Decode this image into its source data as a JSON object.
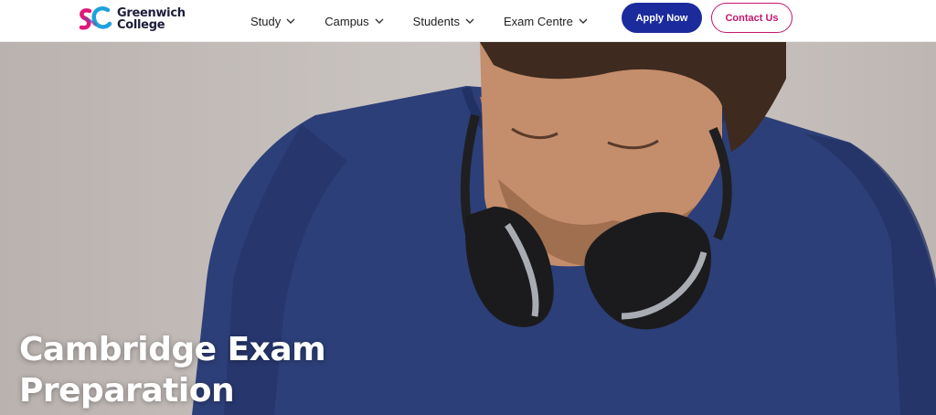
{
  "brand": {
    "line1": "Greenwich",
    "line2": "College",
    "colors": {
      "magenta": "#e0187a",
      "blue": "#1fa2dc",
      "navy": "#1c2b9c"
    }
  },
  "nav": {
    "items": [
      {
        "label": "Study",
        "icon": "chevron-down-icon"
      },
      {
        "label": "Campus",
        "icon": "chevron-down-icon"
      },
      {
        "label": "Students",
        "icon": "chevron-down-icon"
      },
      {
        "label": "Exam Centre",
        "icon": "chevron-down-icon"
      }
    ]
  },
  "actions": {
    "apply_label": "Apply Now",
    "contact_label": "Contact Us",
    "apply_color": "#1c2b9c",
    "contact_color": "#c5166b"
  },
  "hero": {
    "title_line1": "Cambridge Exam",
    "title_line2": "Preparation",
    "image": "man-with-headphones-photo"
  }
}
